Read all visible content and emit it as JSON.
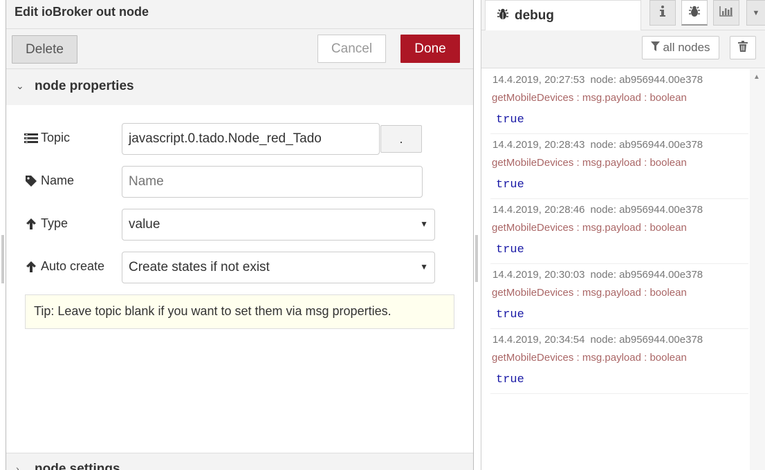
{
  "tray": {
    "title": "Edit ioBroker out node",
    "buttons": {
      "delete": "Delete",
      "cancel": "Cancel",
      "done": "Done"
    },
    "section_properties": "node properties",
    "section_settings": "node settings",
    "fields": {
      "topic": {
        "label": "Topic",
        "value": "javascript.0.tado.Node_red_Tado",
        "button": "."
      },
      "name": {
        "label": "Name",
        "placeholder": "Name"
      },
      "type": {
        "label": "Type",
        "value": "value"
      },
      "auto_create": {
        "label": "Auto create",
        "value": "Create states if not exist"
      }
    },
    "tip": "Tip: Leave topic blank if you want to set them via msg properties."
  },
  "sidebar": {
    "tab_label": "debug",
    "filter_label": "all nodes",
    "messages": [
      {
        "time": "14.4.2019, 20:27:53",
        "node": "node: ab956944.00e378",
        "topic": "getMobileDevices : msg.payload : boolean",
        "value": "true"
      },
      {
        "time": "14.4.2019, 20:28:43",
        "node": "node: ab956944.00e378",
        "topic": "getMobileDevices : msg.payload : boolean",
        "value": "true"
      },
      {
        "time": "14.4.2019, 20:28:46",
        "node": "node: ab956944.00e378",
        "topic": "getMobileDevices : msg.payload : boolean",
        "value": "true"
      },
      {
        "time": "14.4.2019, 20:30:03",
        "node": "node: ab956944.00e378",
        "topic": "getMobileDevices : msg.payload : boolean",
        "value": "true"
      },
      {
        "time": "14.4.2019, 20:34:54",
        "node": "node: ab956944.00e378",
        "topic": "getMobileDevices : msg.payload : boolean",
        "value": "true"
      }
    ]
  },
  "colors": {
    "done_button": "#ad1625",
    "tip_background": "#ffffee",
    "debug_value": "#1a1aa6",
    "debug_topic": "#aa6666"
  }
}
